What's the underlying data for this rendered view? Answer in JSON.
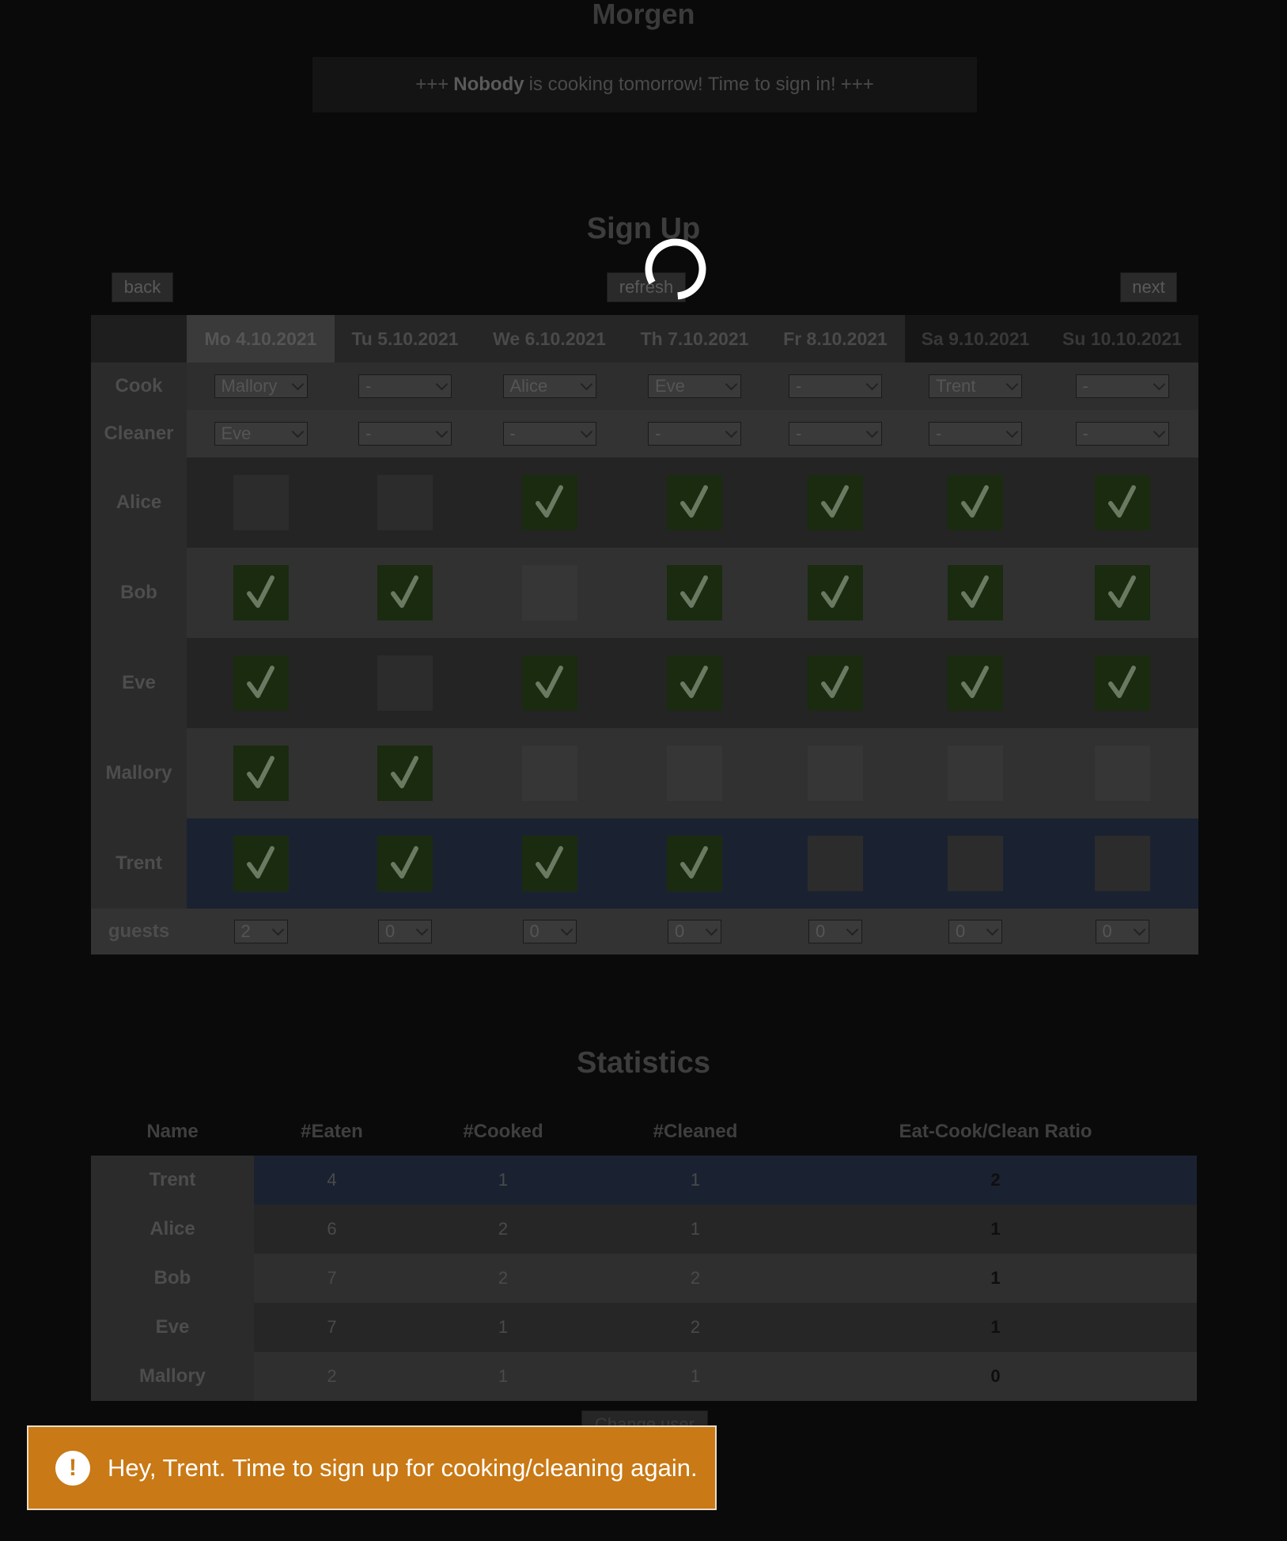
{
  "header": {
    "title": "Morgen"
  },
  "announcement": {
    "prefix": "+++",
    "who": "Nobody",
    "text": "is cooking tomorrow! Time to sign in!",
    "suffix": "+++"
  },
  "signup": {
    "title": "Sign Up",
    "back_label": "back",
    "refresh_label": "refresh",
    "next_label": "next",
    "days": [
      "Mo 4.10.2021",
      "Tu 5.10.2021",
      "We 6.10.2021",
      "Th 7.10.2021",
      "Fr 8.10.2021",
      "Sa 9.10.2021",
      "Su 10.10.2021"
    ],
    "cook_label": "Cook",
    "cleaner_label": "Cleaner",
    "cook": [
      "Mallory",
      "-",
      "Alice",
      "Eve",
      "-",
      "Trent",
      "-"
    ],
    "cleaner": [
      "Eve",
      "-",
      "-",
      "-",
      "-",
      "-",
      "-"
    ],
    "people": [
      {
        "name": "Alice",
        "signed": [
          false,
          false,
          true,
          true,
          true,
          true,
          true
        ]
      },
      {
        "name": "Bob",
        "signed": [
          true,
          true,
          false,
          true,
          true,
          true,
          true
        ]
      },
      {
        "name": "Eve",
        "signed": [
          true,
          false,
          true,
          true,
          true,
          true,
          true
        ]
      },
      {
        "name": "Mallory",
        "signed": [
          true,
          true,
          false,
          false,
          false,
          false,
          false
        ]
      },
      {
        "name": "Trent",
        "signed": [
          true,
          true,
          true,
          true,
          false,
          false,
          false
        ]
      }
    ],
    "guests_label": "guests",
    "guests": [
      "2",
      "0",
      "0",
      "0",
      "0",
      "0",
      "0"
    ]
  },
  "statistics": {
    "title": "Statistics",
    "columns": [
      "Name",
      "#Eaten",
      "#Cooked",
      "#Cleaned",
      "Eat-Cook/Clean Ratio"
    ],
    "rows": [
      [
        "Trent",
        "4",
        "1",
        "1",
        "2"
      ],
      [
        "Alice",
        "6",
        "2",
        "1",
        "1"
      ],
      [
        "Bob",
        "7",
        "2",
        "2",
        "1"
      ],
      [
        "Eve",
        "7",
        "1",
        "2",
        "1"
      ],
      [
        "Mallory",
        "2",
        "1",
        "1",
        "0"
      ]
    ]
  },
  "change_user_label": "Change user",
  "toast": {
    "icon": "exclamation-icon",
    "message": "Hey, Trent. Time to sign up for cooking/cleaning again."
  },
  "colors": {
    "toast": "#c97915",
    "checked": "#1a2b10",
    "current_user_row": "#1a2231"
  }
}
